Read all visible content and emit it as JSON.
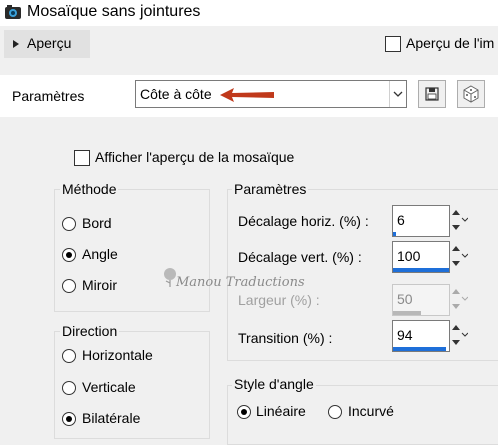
{
  "title": "Mosaïque sans jointures",
  "toolbar": {
    "apercu_label": "Aperçu",
    "apercu_image_label": "Aperçu de l'im"
  },
  "presets": {
    "label": "Paramètres",
    "value": "Côte à côte"
  },
  "show_mosaic_label": "Afficher l'aperçu de la mosaïque",
  "method": {
    "title": "Méthode",
    "options": [
      "Bord",
      "Angle",
      "Miroir"
    ],
    "selected": "Angle"
  },
  "direction": {
    "title": "Direction",
    "options": [
      "Horizontale",
      "Verticale",
      "Bilatérale"
    ],
    "selected": "Bilatérale"
  },
  "params": {
    "title": "Paramètres",
    "h_offset": {
      "label": "Décalage horiz. (%) :",
      "value": "6",
      "level": 0.06
    },
    "v_offset": {
      "label": "Décalage vert. (%) :",
      "value": "100",
      "level": 1.0
    },
    "width": {
      "label": "Largeur (%) :",
      "value": "50",
      "level": 0.5
    },
    "transition": {
      "label": "Transition (%) :",
      "value": "94",
      "level": 0.94
    }
  },
  "corner_style": {
    "title": "Style d'angle",
    "options": [
      "Linéaire",
      "Incurvé"
    ],
    "selected": "Linéaire"
  },
  "watermark": "Manou Traductions",
  "colors": {
    "accent_blue": "#1e6fd9",
    "arrow_red": "#c0391b"
  }
}
